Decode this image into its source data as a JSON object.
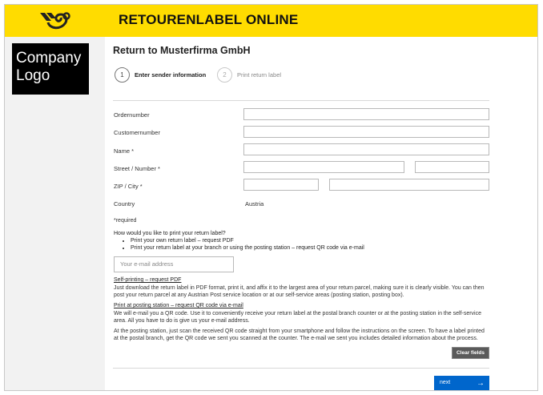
{
  "header": {
    "title": "RETOURENLABEL ONLINE",
    "accent": "#ffdc00"
  },
  "company_logo": {
    "line1": "Company",
    "line2": "Logo"
  },
  "page": {
    "title": "Return to Musterfirma GmbH"
  },
  "steps": [
    {
      "number": "1",
      "label": "Enter sender information"
    },
    {
      "number": "2",
      "label": "Print return label"
    }
  ],
  "form": {
    "ordernumber_label": "Ordernumber",
    "customernumber_label": "Customernumber",
    "name_label": "Name *",
    "street_label": "Street / Number *",
    "zip_label": "ZIP / City *",
    "country_label": "Country",
    "country_value": "Austria",
    "required_note": "*required"
  },
  "print_options": {
    "question": "How would you like to print your return label?",
    "option1": "Print your own return label – request PDF",
    "option2": "Print your return label at your branch or using the posting station – request QR code via e-mail",
    "email_placeholder": "Your e-mail address"
  },
  "self_printing": {
    "heading": "Self-printing – request PDF",
    "text": "Just download the return label in PDF format, print it, and affix it to the largest area of your return parcel, making sure it is clearly visible. You can then post your return parcel at any Austrian Post service location or at our self-service areas (posting station, posting box)."
  },
  "posting_station": {
    "heading": "Print at posting station – request QR code via e-mail",
    "text": "We will e-mail you a QR code. Use it to conveniently receive your return label at the postal branch counter or at the posting station in the self-service area. All you have to do is give us your e-mail address.",
    "text2": "At the posting station, just scan the received QR code straight from your smartphone and follow the instructions on the screen. To have a label printed at the postal branch, get the QR code we sent you scanned at the counter. The e-mail we sent you includes detailed information about the process."
  },
  "buttons": {
    "clear": "Clear fields",
    "next": "next",
    "next_arrow": "→"
  },
  "colors": {
    "primary": "#0066cc",
    "dark_button": "#5a5a5a"
  }
}
